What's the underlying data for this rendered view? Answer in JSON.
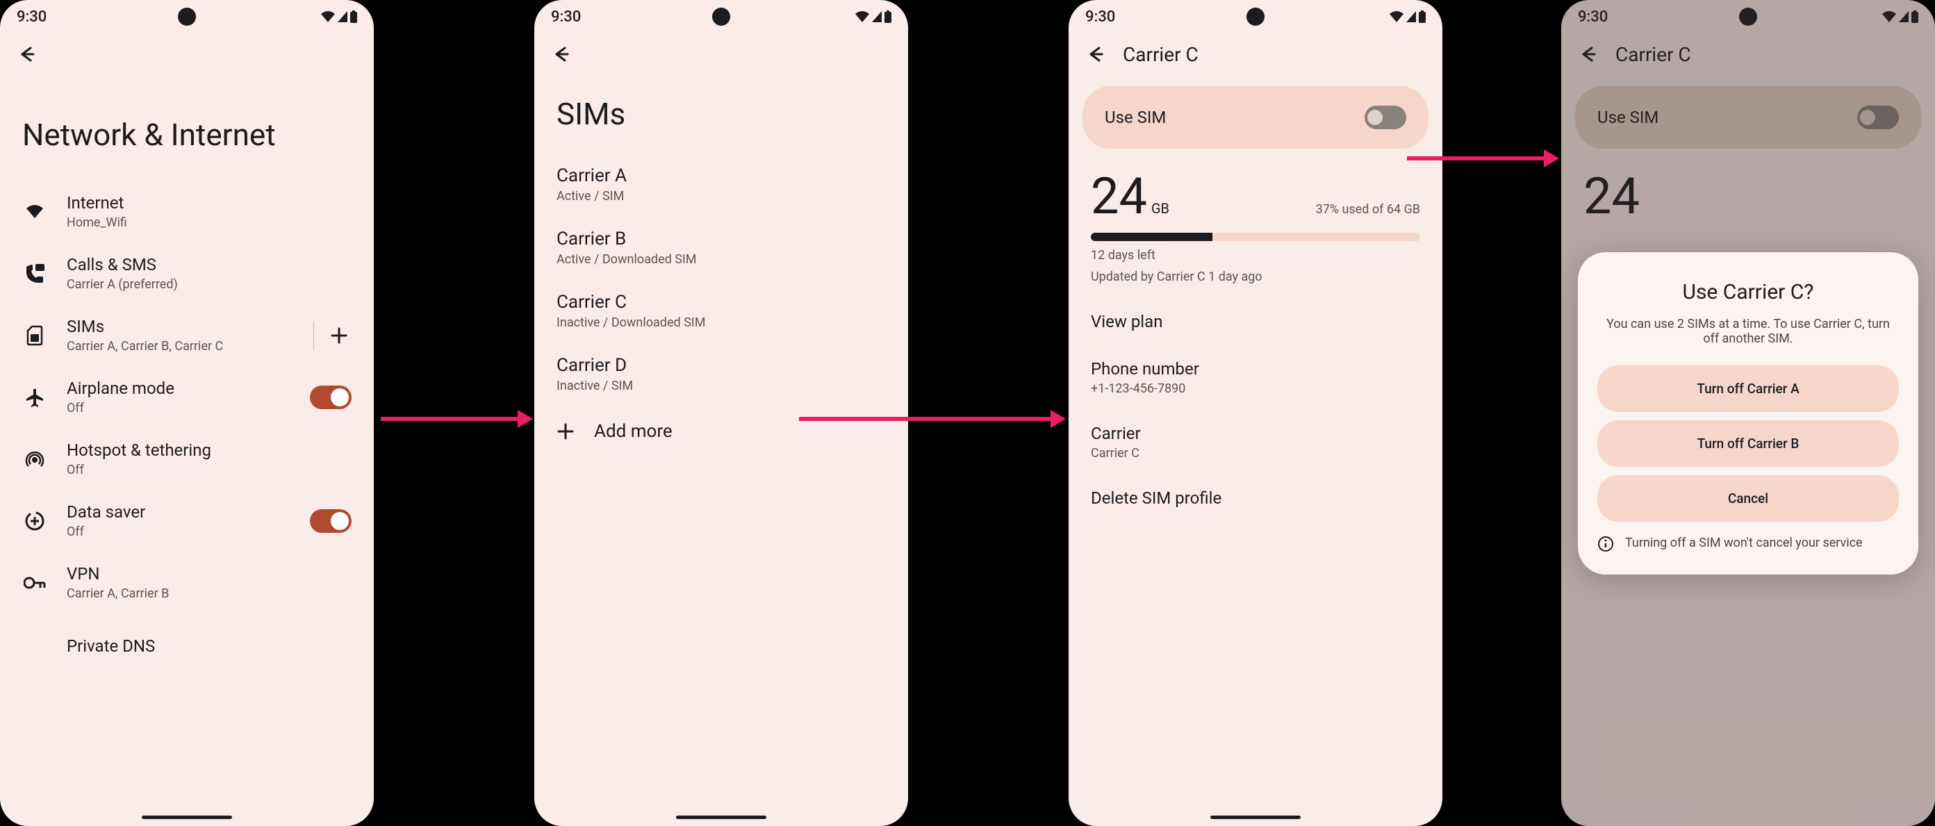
{
  "statusbar": {
    "time": "9:30"
  },
  "screen1": {
    "title": "Network & Internet",
    "internet": {
      "label": "Internet",
      "sub": "Home_Wifi"
    },
    "calls": {
      "label": "Calls & SMS",
      "sub": "Carrier A (preferred)"
    },
    "sims": {
      "label": "SIMs",
      "sub": "Carrier A, Carrier B, Carrier C"
    },
    "airplane": {
      "label": "Airplane mode",
      "sub": "Off"
    },
    "hotspot": {
      "label": "Hotspot & tethering",
      "sub": "Off"
    },
    "datasaver": {
      "label": "Data saver",
      "sub": "Off"
    },
    "vpn": {
      "label": "VPN",
      "sub": "Carrier A, Carrier B"
    },
    "dns": {
      "label": "Private DNS"
    }
  },
  "screen2": {
    "title": "SIMs",
    "carriers": [
      {
        "name": "Carrier A",
        "sub": "Active / SIM"
      },
      {
        "name": "Carrier B",
        "sub": "Active / Downloaded SIM"
      },
      {
        "name": "Carrier C",
        "sub": "Inactive / Downloaded SIM"
      },
      {
        "name": "Carrier D",
        "sub": "Inactive / SIM"
      }
    ],
    "addmore": "Add more"
  },
  "screen3": {
    "title": "Carrier C",
    "use_sim": "Use SIM",
    "data_num": "24",
    "data_unit": "GB",
    "used_text": "37% used of 64 GB",
    "used_pct": 37,
    "days_left": "12 days left",
    "updated": "Updated by Carrier C 1 day ago",
    "view_plan": "View plan",
    "phone_label": "Phone number",
    "phone_value": "+1-123-456-7890",
    "carrier_label": "Carrier",
    "carrier_value": "Carrier C",
    "delete": "Delete SIM profile"
  },
  "screen4": {
    "title": "Carrier C",
    "use_sim": "Use SIM",
    "data_num": "24",
    "dialog": {
      "title": "Use Carrier C?",
      "text": "You can use 2 SIMs at a time. To use Carrier C, turn off another SIM.",
      "btn1": "Turn off Carrier A",
      "btn2": "Turn off Carrier B",
      "btn3": "Cancel",
      "note": "Turning off a SIM won't cancel your service"
    }
  }
}
